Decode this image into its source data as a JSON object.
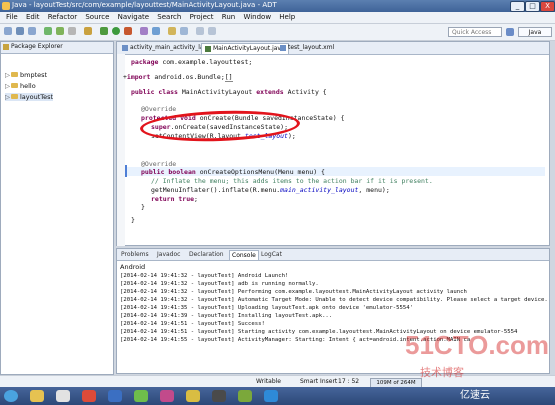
{
  "window": {
    "title": "Java - layoutTest/src/com/example/layouttest/MainActivityLayout.java - ADT",
    "min_label": "_",
    "max_label": "□",
    "close_label": "X"
  },
  "menu": [
    "File",
    "Edit",
    "Refactor",
    "Source",
    "Navigate",
    "Search",
    "Project",
    "Run",
    "Window",
    "Help"
  ],
  "toolbar": {
    "quick_access_placeholder": "Quick Access",
    "perspective_label": "Java"
  },
  "package_explorer": {
    "title": "Package Explorer",
    "projects": [
      "bmptest",
      "hello",
      "layoutTest"
    ]
  },
  "editor": {
    "tabs": [
      "activity_main_activity_layout.xml",
      "MainActivityLayout.java",
      "test_layout.xml"
    ],
    "active_tab": 1
  },
  "console": {
    "tabs": [
      "Problems",
      "Javadoc",
      "Declaration",
      "Console",
      "LogCat"
    ],
    "active_tab": 3,
    "device": "Android",
    "lines": [
      "[2014-02-14 19:41:32 - layoutTest] Android Launch!",
      "[2014-02-14 19:41:32 - layoutTest] adb is running normally.",
      "[2014-02-14 19:41:32 - layoutTest] Performing com.example.layouttest.MainActivityLayout activity launch",
      "[2014-02-14 19:41:32 - layoutTest] Automatic Target Mode: Unable to detect device compatibility. Please select a target device.",
      "[2014-02-14 19:41:35 - layoutTest] Uploading layoutTest.apk onto device 'emulator-5554'",
      "[2014-02-14 19:41:39 - layoutTest] Installing layoutTest.apk...",
      "[2014-02-14 19:41:51 - layoutTest] Success!",
      "[2014-02-14 19:41:51 - layoutTest] Starting activity com.example.layouttest.MainActivityLayout on device emulator-5554",
      "[2014-02-14 19:41:55 - layoutTest] ActivityManager: Starting: Intent { act=android.intent.action.MAIN ca"
    ]
  },
  "status": {
    "mode": "Writable",
    "insert": "Smart Insert",
    "position": "17 : 52",
    "memory": "109M of 264M"
  },
  "watermark": {
    "site": "51CTO.com",
    "sub": "技术博客",
    "brand": "亿速云"
  }
}
